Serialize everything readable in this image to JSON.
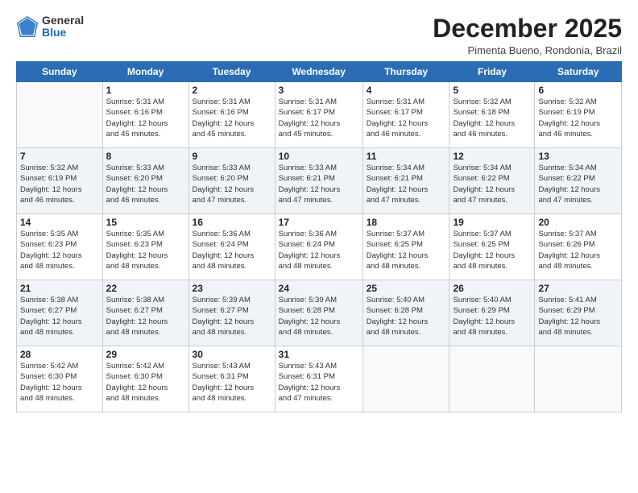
{
  "header": {
    "logo_general": "General",
    "logo_blue": "Blue",
    "month_title": "December 2025",
    "location": "Pimenta Bueno, Rondonia, Brazil"
  },
  "days_of_week": [
    "Sunday",
    "Monday",
    "Tuesday",
    "Wednesday",
    "Thursday",
    "Friday",
    "Saturday"
  ],
  "weeks": [
    [
      {
        "day": "",
        "info": ""
      },
      {
        "day": "1",
        "info": "Sunrise: 5:31 AM\nSunset: 6:16 PM\nDaylight: 12 hours\nand 45 minutes."
      },
      {
        "day": "2",
        "info": "Sunrise: 5:31 AM\nSunset: 6:16 PM\nDaylight: 12 hours\nand 45 minutes."
      },
      {
        "day": "3",
        "info": "Sunrise: 5:31 AM\nSunset: 6:17 PM\nDaylight: 12 hours\nand 45 minutes."
      },
      {
        "day": "4",
        "info": "Sunrise: 5:31 AM\nSunset: 6:17 PM\nDaylight: 12 hours\nand 46 minutes."
      },
      {
        "day": "5",
        "info": "Sunrise: 5:32 AM\nSunset: 6:18 PM\nDaylight: 12 hours\nand 46 minutes."
      },
      {
        "day": "6",
        "info": "Sunrise: 5:32 AM\nSunset: 6:19 PM\nDaylight: 12 hours\nand 46 minutes."
      }
    ],
    [
      {
        "day": "7",
        "info": "Sunrise: 5:32 AM\nSunset: 6:19 PM\nDaylight: 12 hours\nand 46 minutes."
      },
      {
        "day": "8",
        "info": "Sunrise: 5:33 AM\nSunset: 6:20 PM\nDaylight: 12 hours\nand 46 minutes."
      },
      {
        "day": "9",
        "info": "Sunrise: 5:33 AM\nSunset: 6:20 PM\nDaylight: 12 hours\nand 47 minutes."
      },
      {
        "day": "10",
        "info": "Sunrise: 5:33 AM\nSunset: 6:21 PM\nDaylight: 12 hours\nand 47 minutes."
      },
      {
        "day": "11",
        "info": "Sunrise: 5:34 AM\nSunset: 6:21 PM\nDaylight: 12 hours\nand 47 minutes."
      },
      {
        "day": "12",
        "info": "Sunrise: 5:34 AM\nSunset: 6:22 PM\nDaylight: 12 hours\nand 47 minutes."
      },
      {
        "day": "13",
        "info": "Sunrise: 5:34 AM\nSunset: 6:22 PM\nDaylight: 12 hours\nand 47 minutes."
      }
    ],
    [
      {
        "day": "14",
        "info": "Sunrise: 5:35 AM\nSunset: 6:23 PM\nDaylight: 12 hours\nand 48 minutes."
      },
      {
        "day": "15",
        "info": "Sunrise: 5:35 AM\nSunset: 6:23 PM\nDaylight: 12 hours\nand 48 minutes."
      },
      {
        "day": "16",
        "info": "Sunrise: 5:36 AM\nSunset: 6:24 PM\nDaylight: 12 hours\nand 48 minutes."
      },
      {
        "day": "17",
        "info": "Sunrise: 5:36 AM\nSunset: 6:24 PM\nDaylight: 12 hours\nand 48 minutes."
      },
      {
        "day": "18",
        "info": "Sunrise: 5:37 AM\nSunset: 6:25 PM\nDaylight: 12 hours\nand 48 minutes."
      },
      {
        "day": "19",
        "info": "Sunrise: 5:37 AM\nSunset: 6:25 PM\nDaylight: 12 hours\nand 48 minutes."
      },
      {
        "day": "20",
        "info": "Sunrise: 5:37 AM\nSunset: 6:26 PM\nDaylight: 12 hours\nand 48 minutes."
      }
    ],
    [
      {
        "day": "21",
        "info": "Sunrise: 5:38 AM\nSunset: 6:27 PM\nDaylight: 12 hours\nand 48 minutes."
      },
      {
        "day": "22",
        "info": "Sunrise: 5:38 AM\nSunset: 6:27 PM\nDaylight: 12 hours\nand 48 minutes."
      },
      {
        "day": "23",
        "info": "Sunrise: 5:39 AM\nSunset: 6:27 PM\nDaylight: 12 hours\nand 48 minutes."
      },
      {
        "day": "24",
        "info": "Sunrise: 5:39 AM\nSunset: 6:28 PM\nDaylight: 12 hours\nand 48 minutes."
      },
      {
        "day": "25",
        "info": "Sunrise: 5:40 AM\nSunset: 6:28 PM\nDaylight: 12 hours\nand 48 minutes."
      },
      {
        "day": "26",
        "info": "Sunrise: 5:40 AM\nSunset: 6:29 PM\nDaylight: 12 hours\nand 48 minutes."
      },
      {
        "day": "27",
        "info": "Sunrise: 5:41 AM\nSunset: 6:29 PM\nDaylight: 12 hours\nand 48 minutes."
      }
    ],
    [
      {
        "day": "28",
        "info": "Sunrise: 5:42 AM\nSunset: 6:30 PM\nDaylight: 12 hours\nand 48 minutes."
      },
      {
        "day": "29",
        "info": "Sunrise: 5:42 AM\nSunset: 6:30 PM\nDaylight: 12 hours\nand 48 minutes."
      },
      {
        "day": "30",
        "info": "Sunrise: 5:43 AM\nSunset: 6:31 PM\nDaylight: 12 hours\nand 48 minutes."
      },
      {
        "day": "31",
        "info": "Sunrise: 5:43 AM\nSunset: 6:31 PM\nDaylight: 12 hours\nand 47 minutes."
      },
      {
        "day": "",
        "info": ""
      },
      {
        "day": "",
        "info": ""
      },
      {
        "day": "",
        "info": ""
      }
    ]
  ]
}
